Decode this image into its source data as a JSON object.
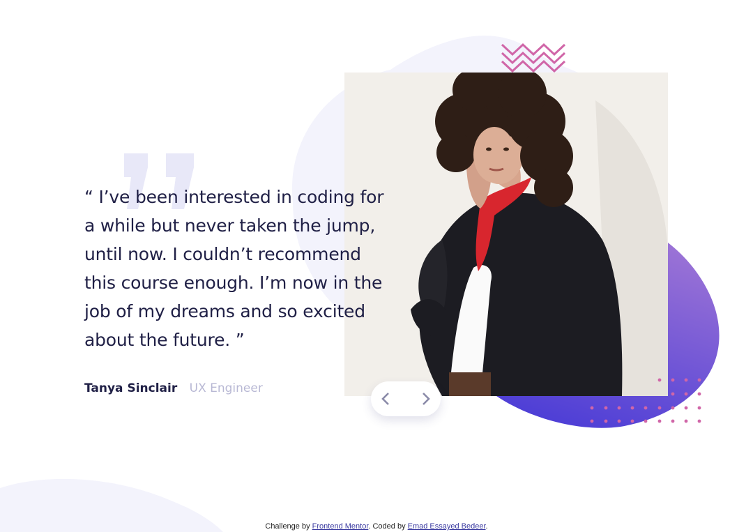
{
  "testimonial": {
    "quote": "“ I’ve been interested in coding for a while but never taken the jump, until now. I couldn’t recommend this course enough. I’m now in the job of my dreams and so excited about the future. ”",
    "quote_lines": [
      "“ I’ve been interested in coding for",
      "a while but never taken the jump,",
      "until now. I couldn’t recommend",
      "this course enough. I’m now in the",
      "job of my dreams and so excited",
      "about the future. ”"
    ],
    "author_name": "Tanya Sinclair",
    "author_role": "UX Engineer"
  },
  "nav": {
    "prev_icon": "chevron-left-icon",
    "next_icon": "chevron-right-icon"
  },
  "footer": {
    "prefix": "Challenge by ",
    "link1": "Frontend Mentor",
    "middle": ". Coded by ",
    "link2": "Emad Essayed Bedeer",
    "suffix": "."
  },
  "colors": {
    "text_dark": "#202046",
    "text_muted": "#b8b8d4",
    "blob_light": "#f3f3fc",
    "blob_gradient_start": "#9a72d6",
    "blob_gradient_end": "#4d3ed6",
    "accent_pink": "#d066a8",
    "quote_mark": "#e8e8f8"
  }
}
